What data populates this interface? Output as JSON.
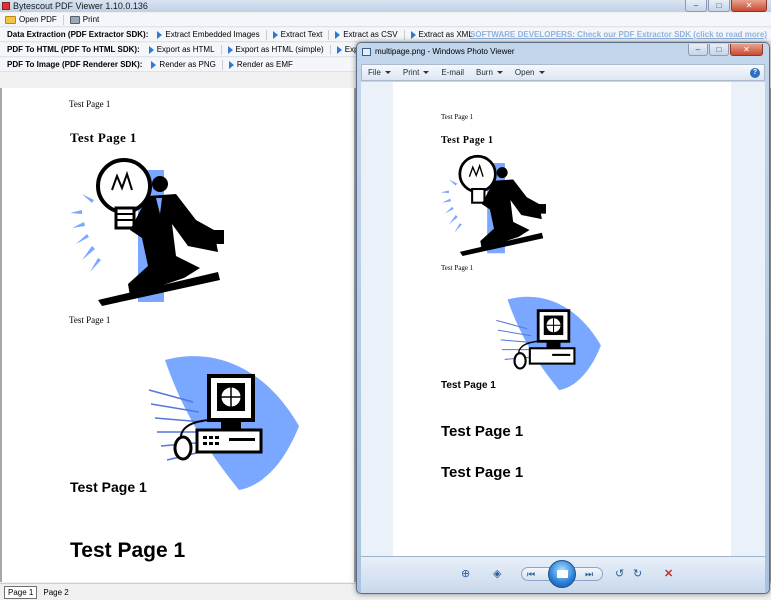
{
  "main_window": {
    "title": "Bytescout PDF Viewer 1.10.0.136"
  },
  "toolbar_main": {
    "open_pdf": "Open PDF",
    "print": "Print"
  },
  "toolbar_extraction": {
    "group_label": "Data Extraction (PDF Extractor SDK):",
    "extract_images": "Extract Embedded Images",
    "extract_text": "Extract Text",
    "extract_csv": "Extract as CSV",
    "extract_xml": "Extract as XML",
    "promo_link": "SOFTWARE DEVELOPERS: Check our PDF Extractor SDK (click to read more)"
  },
  "toolbar_html": {
    "group_label": "PDF To HTML (PDF To HTML SDK):",
    "export_html": "Export as HTML",
    "export_html_simple": "Export as HTML (simple)",
    "export_word": "Export to Word"
  },
  "toolbar_image": {
    "group_label": "PDF To Image (PDF Renderer SDK):",
    "render_png": "Render as PNG",
    "render_emf": "Render as EMF"
  },
  "document": {
    "line1": "Test Page 1",
    "heading1": "Test Page 1",
    "line2": "Test Page 1",
    "heading2": "Test Page 1",
    "heading3": "Test Page 1"
  },
  "page_tabs": [
    "Page 1",
    "Page 2"
  ],
  "photo_viewer": {
    "title": "multipage.png - Windows Photo Viewer",
    "menu": [
      "File",
      "Print",
      "E-mail",
      "Burn",
      "Open"
    ],
    "help": "?",
    "page": {
      "line1": "Test Page 1",
      "heading1": "Test Page 1",
      "line2": "Test Page 1",
      "heading2": "Test Page 1",
      "heading3": "Test Page 1",
      "heading4": "Test Page 1"
    }
  },
  "colors": {
    "accent": "#2b7bd4",
    "clipart_blue": "#7aa7ff",
    "promo": "#8fb3dd"
  }
}
